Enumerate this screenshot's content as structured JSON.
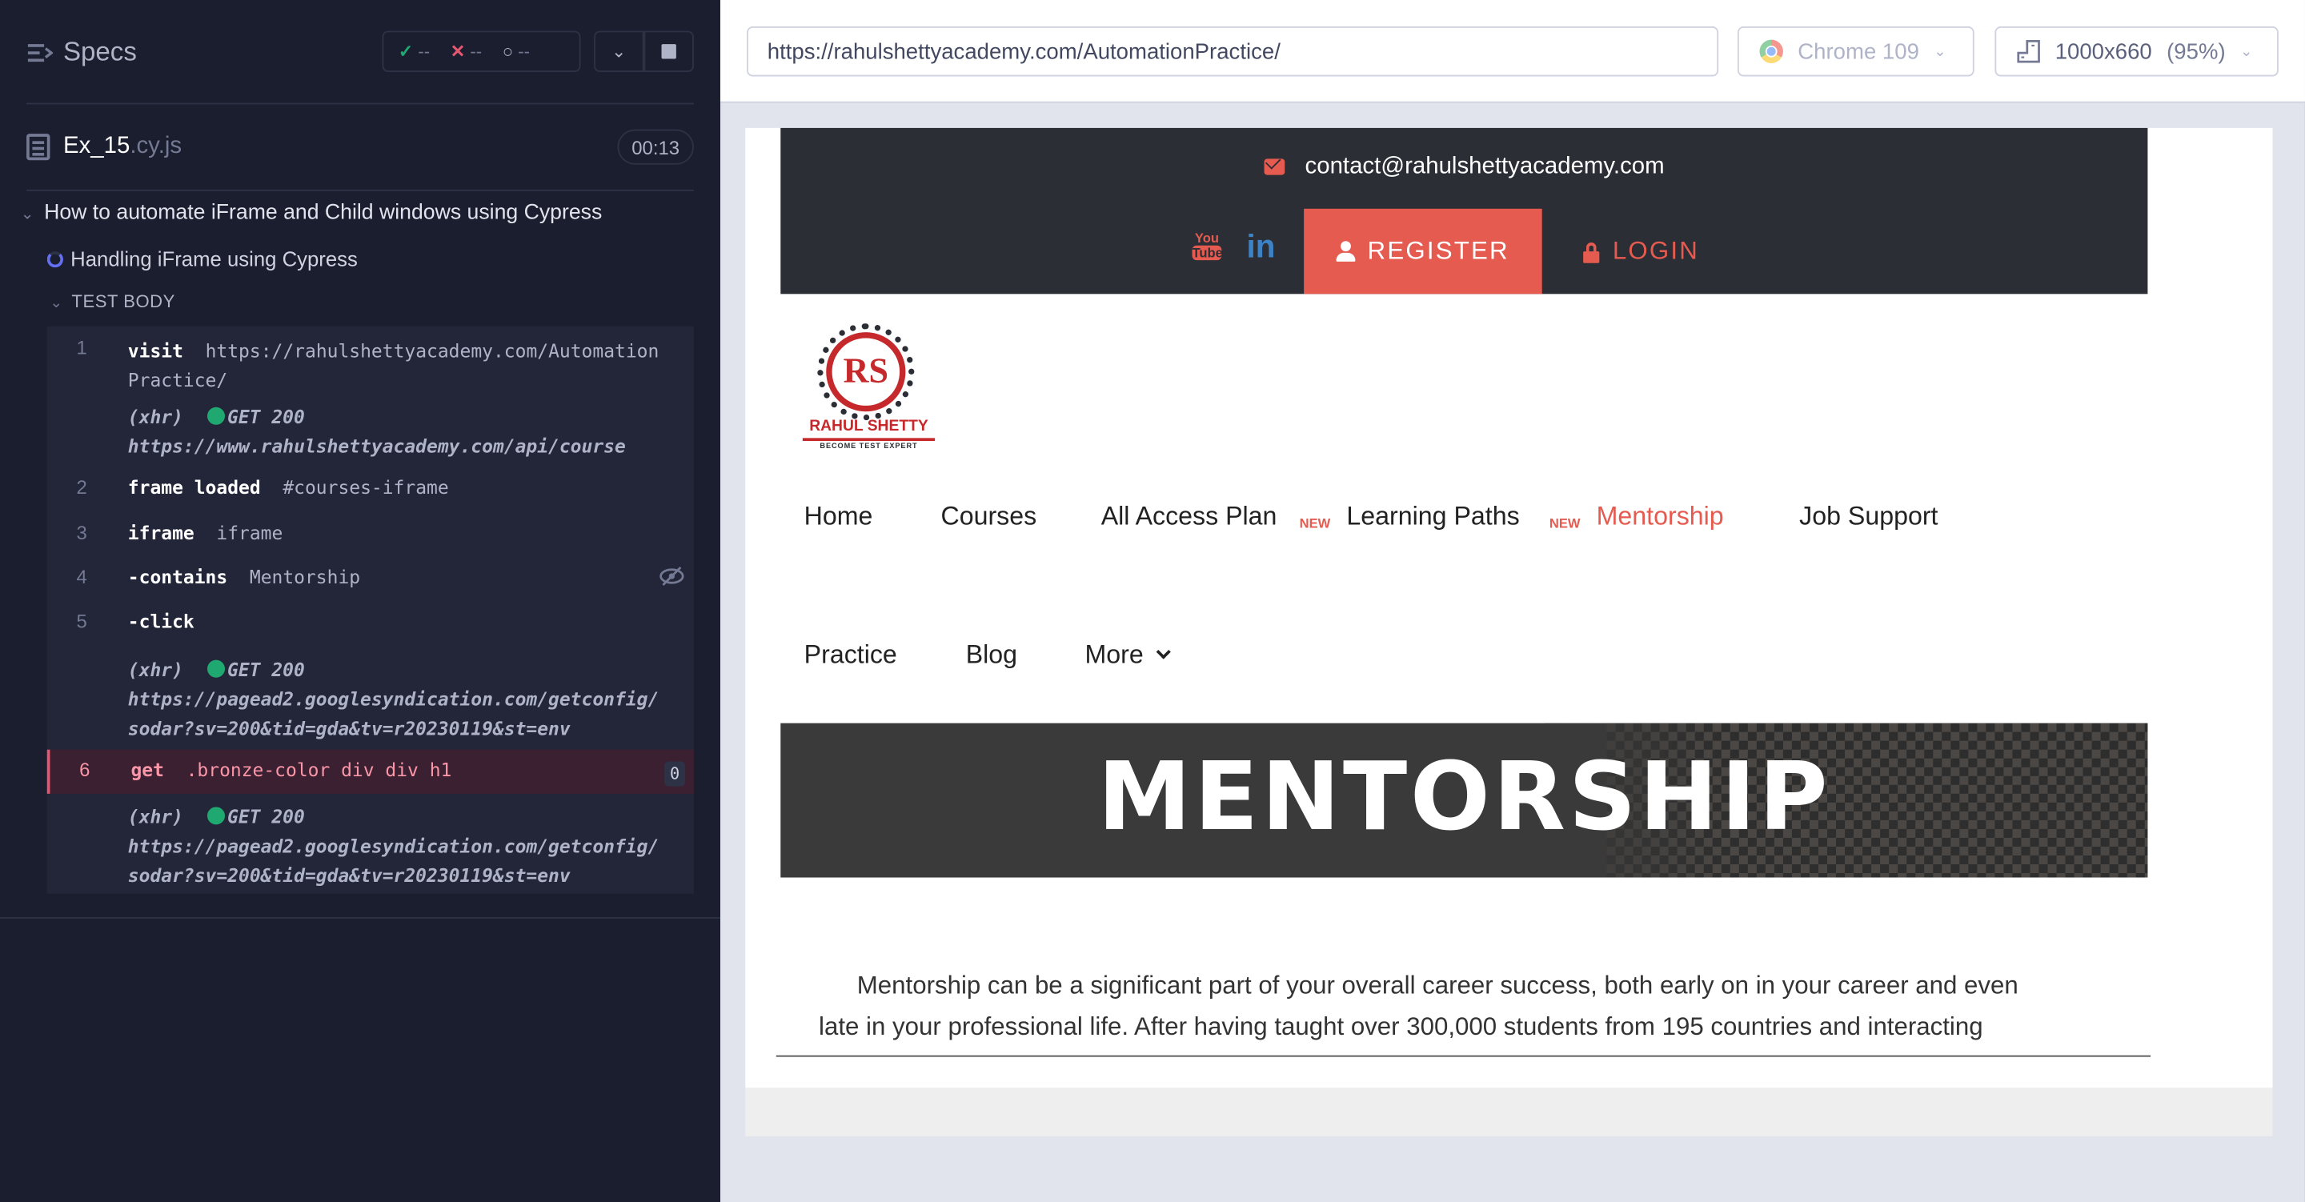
{
  "runner": {
    "specs_title": "Specs",
    "stats": {
      "passed": "--",
      "failed": "--",
      "pending": "--"
    },
    "file": {
      "name": "Ex_15",
      "ext": ".cy.js",
      "duration": "00:13"
    },
    "suite_title": "How to automate iFrame and Child windows using Cypress",
    "test_title": "Handling iFrame using Cypress",
    "test_body_label": "TEST BODY",
    "commands": [
      {
        "num": "1",
        "name": "visit",
        "msg": "https://rahulshettyacademy.com/Automation",
        "msg2": "Practice/"
      },
      {
        "xhr": "(xhr)",
        "status": "GET 200",
        "url": "https://www.rahulshettyacademy.com/api/course"
      },
      {
        "num": "2",
        "name": "frame loaded",
        "msg": "#courses-iframe"
      },
      {
        "num": "3",
        "name": "iframe",
        "msg": "iframe"
      },
      {
        "num": "4",
        "name": "-contains",
        "msg": "Mentorship"
      },
      {
        "num": "5",
        "name": "-click",
        "msg": ""
      },
      {
        "xhr": "(xhr)",
        "status": "GET 200",
        "url": "https://pagead2.googlesyndication.com/getconfig/",
        "url2": "sodar?sv=200&tid=gda&tv=r20230119&st=env"
      },
      {
        "num": "6",
        "name": "get",
        "msg": ".bronze-color div div h1",
        "badge": "0"
      },
      {
        "xhr": "(xhr)",
        "status": "GET 200",
        "url": "https://pagead2.googlesyndication.com/getconfig/",
        "url2": "sodar?sv=200&tid=gda&tv=r20230119&st=env"
      }
    ]
  },
  "browser_bar": {
    "url": "https://rahulshettyacademy.com/AutomationPractice/",
    "browser": "Chrome 109",
    "viewport": "1000x660",
    "zoom": "(95%)"
  },
  "site": {
    "email": "contact@rahulshettyacademy.com",
    "register": "REGISTER",
    "login": "LOGIN",
    "logo_text": "RAHUL SHETTY",
    "logo_sub": "BECOME TEST EXPERT",
    "logo_mark": "RS",
    "youtube": "You",
    "youtube2": "Tube",
    "linkedin": "in",
    "nav": [
      "Home",
      "Courses",
      "All Access Plan",
      "Learning Paths",
      "Mentorship",
      "Job Support",
      "Practice",
      "Blog",
      "More"
    ],
    "new_badge": "NEW",
    "banner_title": "MENTORSHIP",
    "para_line1": "Mentorship can be a significant part of your overall career success, both early on in your career and even",
    "para_line2": "late in your professional life. After having taught over 300,000 students from 195 countries and interacting"
  },
  "colors": {
    "accent": "#e55b50",
    "runner_bg": "#1b1e2e",
    "pass": "#1fa971",
    "fail": "#e45770"
  }
}
